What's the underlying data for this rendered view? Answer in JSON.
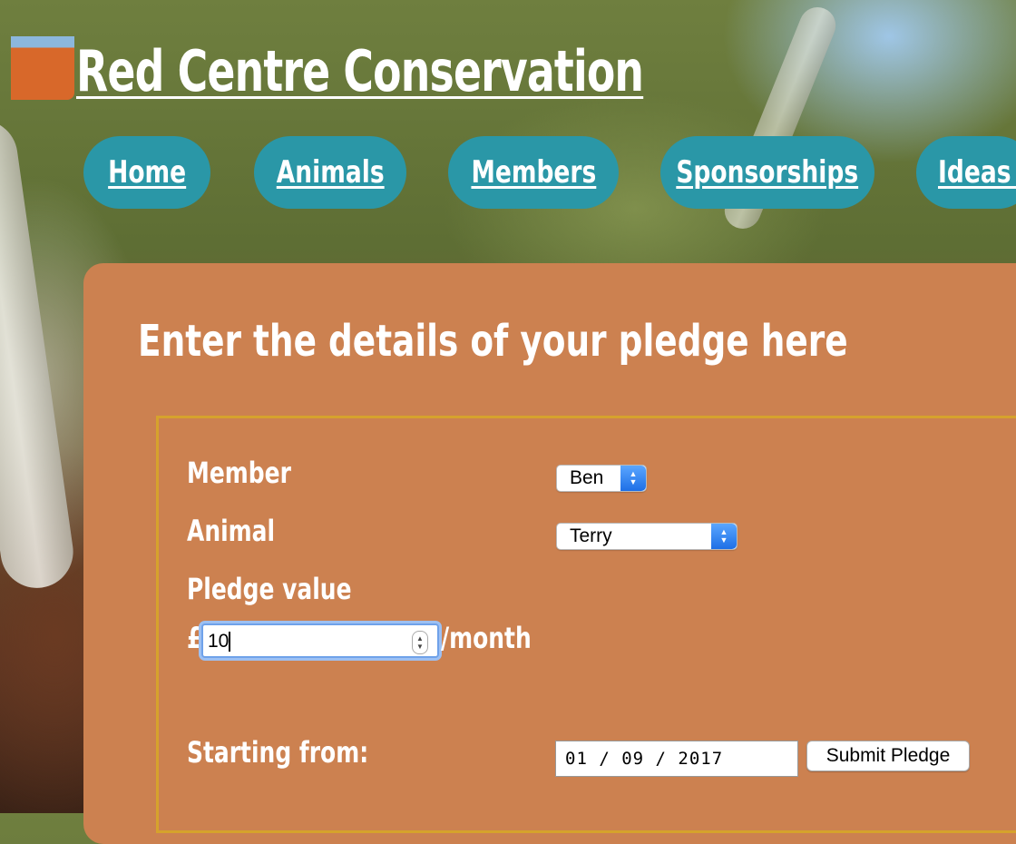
{
  "site": {
    "title": "Red Centre Conservation",
    "logo": "outback-logo-image"
  },
  "nav": {
    "items": [
      {
        "label": "Home"
      },
      {
        "label": "Animals"
      },
      {
        "label": "Members"
      },
      {
        "label": "Sponsorships"
      },
      {
        "label": "Ideas f"
      }
    ]
  },
  "form": {
    "heading": "Enter the details of your pledge here",
    "member_label": "Member",
    "member_value": "Ben",
    "animal_label": "Animal",
    "animal_value": "Terry",
    "pledge_label": "Pledge value",
    "currency": "£",
    "pledge_value": "10",
    "period": "/month",
    "start_label": "Starting from:",
    "start_value": "01 / 09 / 2017",
    "submit_label": "Submit Pledge"
  },
  "colors": {
    "nav_bg": "#2a97a7",
    "panel_bg": "#cc8150",
    "form_border": "#d6a22c"
  }
}
